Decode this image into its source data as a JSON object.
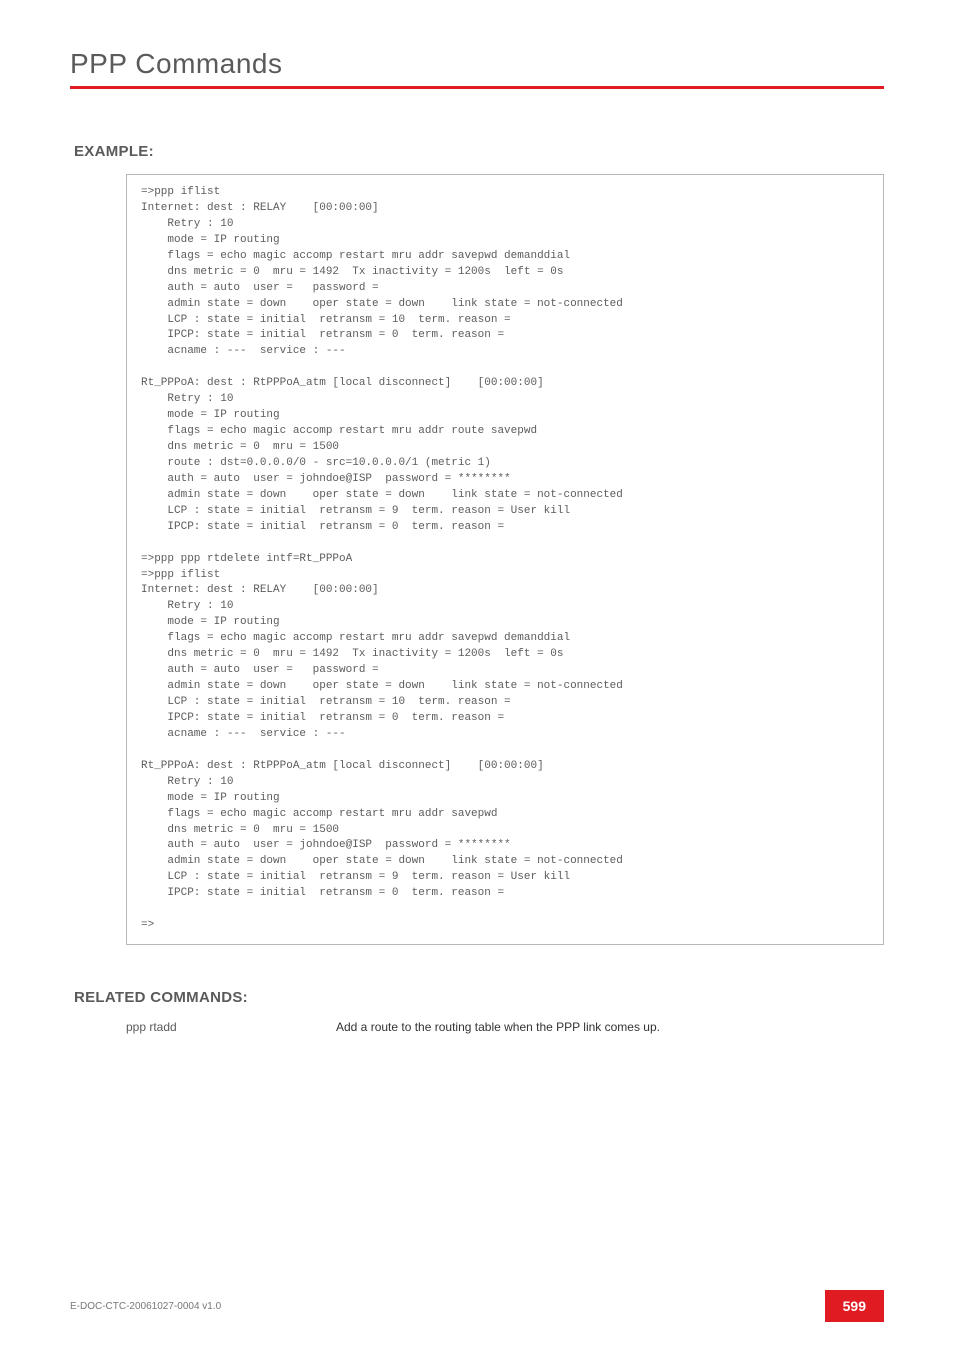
{
  "chapter": {
    "title": "PPP Commands"
  },
  "sections": {
    "example_label": "EXAMPLE:",
    "related_label": "RELATED COMMANDS:"
  },
  "code": "=>ppp iflist\nInternet: dest : RELAY    [00:00:00]\n    Retry : 10\n    mode = IP routing\n    flags = echo magic accomp restart mru addr savepwd demanddial\n    dns metric = 0  mru = 1492  Tx inactivity = 1200s  left = 0s\n    auth = auto  user =   password =\n    admin state = down    oper state = down    link state = not-connected\n    LCP : state = initial  retransm = 10  term. reason =\n    IPCP: state = initial  retransm = 0  term. reason =\n    acname : ---  service : ---\n\nRt_PPPoA: dest : RtPPPoA_atm [local disconnect]    [00:00:00]\n    Retry : 10\n    mode = IP routing\n    flags = echo magic accomp restart mru addr route savepwd\n    dns metric = 0  mru = 1500\n    route : dst=0.0.0.0/0 - src=10.0.0.0/1 (metric 1)\n    auth = auto  user = johndoe@ISP  password = ********\n    admin state = down    oper state = down    link state = not-connected\n    LCP : state = initial  retransm = 9  term. reason = User kill\n    IPCP: state = initial  retransm = 0  term. reason =\n\n=>ppp ppp rtdelete intf=Rt_PPPoA\n=>ppp iflist\nInternet: dest : RELAY    [00:00:00]\n    Retry : 10\n    mode = IP routing\n    flags = echo magic accomp restart mru addr savepwd demanddial\n    dns metric = 0  mru = 1492  Tx inactivity = 1200s  left = 0s\n    auth = auto  user =   password =\n    admin state = down    oper state = down    link state = not-connected\n    LCP : state = initial  retransm = 10  term. reason =\n    IPCP: state = initial  retransm = 0  term. reason =\n    acname : ---  service : ---\n\nRt_PPPoA: dest : RtPPPoA_atm [local disconnect]    [00:00:00]\n    Retry : 10\n    mode = IP routing\n    flags = echo magic accomp restart mru addr savepwd\n    dns metric = 0  mru = 1500\n    auth = auto  user = johndoe@ISP  password = ********\n    admin state = down    oper state = down    link state = not-connected\n    LCP : state = initial  retransm = 9  term. reason = User kill\n    IPCP: state = initial  retransm = 0  term. reason =\n\n=>",
  "related": {
    "command": "ppp rtadd",
    "description": "Add a route to the routing table when the PPP link comes up."
  },
  "footer": {
    "doc_id": "E-DOC-CTC-20061027-0004 v1.0",
    "page_number": "599"
  }
}
